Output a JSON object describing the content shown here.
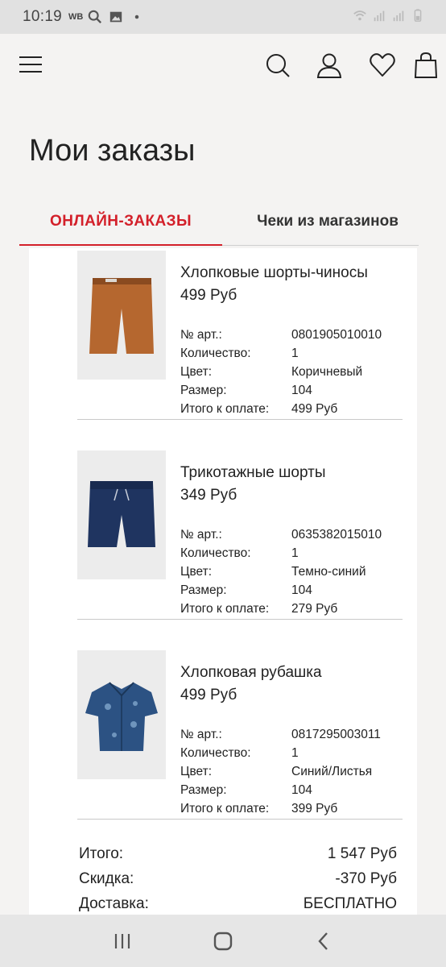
{
  "status": {
    "time": "10:19",
    "carrier": "WB"
  },
  "header": {
    "menu_icon": "hamburger-icon",
    "search_icon": "search-icon",
    "account_icon": "user-icon",
    "favorites_icon": "heart-icon",
    "bag_icon": "shopping-bag-icon"
  },
  "page": {
    "title": "Мои заказы"
  },
  "tabs": [
    {
      "label": "ОНЛАЙН-ЗАКАЗЫ",
      "active": true
    },
    {
      "label": "Чеки из магазинов",
      "active": false
    }
  ],
  "labels": {
    "art": "№ арт.:",
    "qty": "Количество:",
    "color": "Цвет:",
    "size": "Размер:",
    "total_to_pay": "Итого к оплате:"
  },
  "items": [
    {
      "name": "Хлопковые шорты-чиносы",
      "price": "499 Руб",
      "art": "0801905010010",
      "qty": "1",
      "color": "Коричневый",
      "size": "104",
      "total": "499 Руб",
      "image_color": "#b5672f"
    },
    {
      "name": "Трикотажные шорты",
      "price": "349 Руб",
      "art": "0635382015010",
      "qty": "1",
      "color": "Темно-синий",
      "size": "104",
      "total": "279 Руб",
      "image_color": "#1f3460"
    },
    {
      "name": "Хлопковая рубашка",
      "price": "499 Руб",
      "art": "0817295003011",
      "qty": "1",
      "color": "Синий/Листья",
      "size": "104",
      "total": "399 Руб",
      "image_color": "#2c5283"
    }
  ],
  "totals": {
    "subtotal_label": "Итого:",
    "subtotal_value": "1 547 Руб",
    "discount_label": "Скидка:",
    "discount_value": "-370 Руб",
    "delivery_label": "Доставка:",
    "delivery_value": "БЕСПЛАТНО"
  },
  "navbar": {
    "recents_icon": "recents-icon",
    "home_icon": "home-icon",
    "back_icon": "back-icon"
  }
}
